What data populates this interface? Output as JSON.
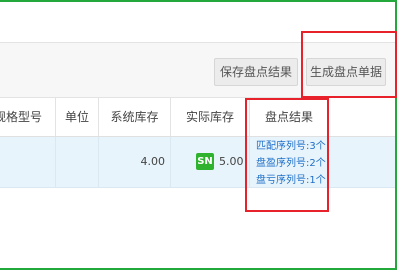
{
  "toolbar": {
    "save_label": "保存盘点结果",
    "generate_label": "生成盘点单据"
  },
  "table": {
    "headers": {
      "model": "规格型号",
      "unit": "单位",
      "system_stock": "系统库存",
      "actual_stock": "实际库存",
      "result": "盘点结果"
    },
    "row": {
      "system_stock": "4.00",
      "sn_badge": "SN",
      "actual_stock": "5.00",
      "result_links": [
        "匹配序列号:3个",
        "盘盈序列号:2个",
        "盘亏序列号:1个"
      ]
    }
  },
  "colors": {
    "frame_border": "#22a83b",
    "highlight_box": "#e8222a",
    "link": "#1e6fc8",
    "row_highlight": "#e8f4fb",
    "sn_badge": "#2fb32f"
  }
}
